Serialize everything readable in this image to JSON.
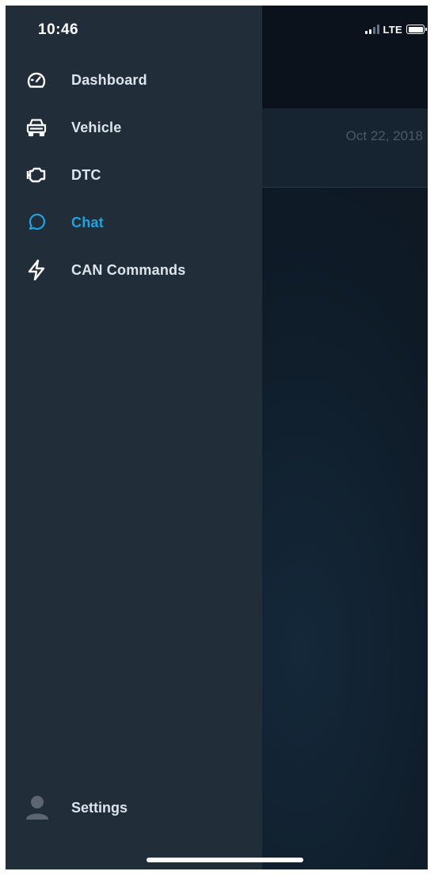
{
  "status_bar": {
    "time": "10:46",
    "network": "LTE"
  },
  "background": {
    "row_date": "Oct 22, 2018"
  },
  "drawer": {
    "items": [
      {
        "label": "Dashboard",
        "icon": "speedometer-icon",
        "active": false
      },
      {
        "label": "Vehicle",
        "icon": "car-icon",
        "active": false
      },
      {
        "label": "DTC",
        "icon": "engine-icon",
        "active": false
      },
      {
        "label": "Chat",
        "icon": "chat-bubble-icon",
        "active": true
      },
      {
        "label": "CAN Commands",
        "icon": "lightning-icon",
        "active": false
      }
    ],
    "settings_label": "Settings"
  },
  "colors": {
    "drawer_bg": "#222d3a",
    "active_accent": "#1fa3e0",
    "label_text": "#dce4ec",
    "backdrop": "#0c141d"
  }
}
